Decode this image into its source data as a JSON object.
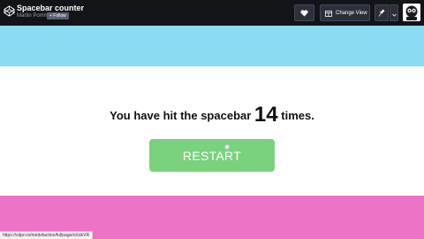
{
  "header": {
    "title": "Spacebar counter",
    "author": "Martin Pomme",
    "follow_label": "+ Follow",
    "change_view_label": "Change View",
    "icons": [
      "codepen-logo-icon",
      "heart-icon",
      "layout-icon",
      "pin-icon",
      "chevron-down-icon",
      "avatar"
    ]
  },
  "main": {
    "message_prefix": "You have hit the spacebar",
    "count": "14",
    "message_suffix": "times.",
    "restart_label": "RESTART"
  },
  "status_bar": {
    "url": "https://cdpn.io/mettsfaction/fullpage/oXdsVR"
  },
  "colors": {
    "header_bg": "#131417",
    "band_top": "#89dcf2",
    "band_bottom": "#ec73c6",
    "restart_bg": "#7ad27d"
  }
}
